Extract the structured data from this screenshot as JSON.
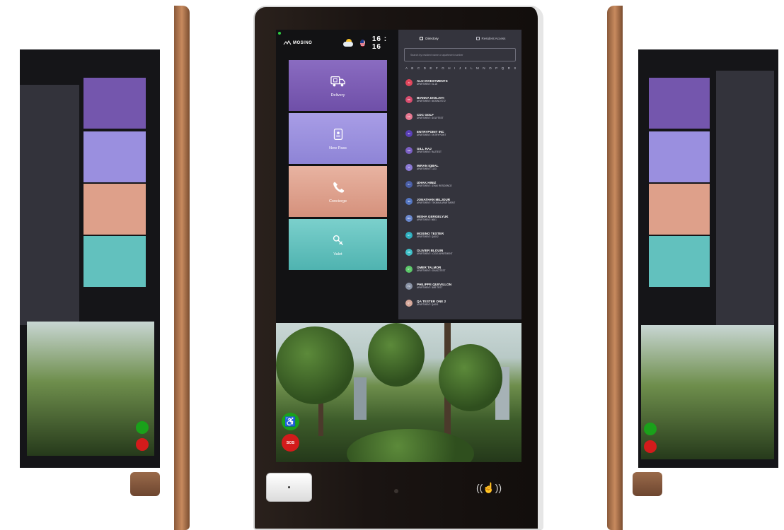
{
  "kiosk": {
    "brand": "MOSINO",
    "time": "16 : 16",
    "tiles": [
      {
        "key": "delivery",
        "label": "Delivery",
        "icon": "delivery-truck-icon"
      },
      {
        "key": "newpass",
        "label": "New Pass",
        "icon": "id-pass-icon"
      },
      {
        "key": "concierge",
        "label": "Concierge",
        "icon": "phone-icon"
      },
      {
        "key": "valet",
        "label": "Valet",
        "icon": "car-key-icon"
      }
    ],
    "tabs": {
      "directory": "Directory",
      "resident_access": "Resident Access"
    },
    "search_placeholder": "Search by resident name or apartment number",
    "alphabet": "A B C D E F G H I J K L M N O P Q R S T U V W X",
    "directory": [
      {
        "initials": "AI",
        "name": "ALO INVESTMENTS",
        "apt": "APARTMENT: 01-18",
        "color": "#e0455b"
      },
      {
        "initials": "BD",
        "name": "BIANKA DIOLAITI",
        "apt": "APARTMENT: MOSINO7072",
        "color": "#d94d6e"
      },
      {
        "initials": "CG",
        "name": "CDC GOLF",
        "apt": "APARTMENT: GOLFTEST",
        "color": "#e87891"
      },
      {
        "initials": "EI",
        "name": "ENTRYPOINT INC",
        "apt": "APARTMENT: ENTRYPOINT",
        "color": "#5a3fb8"
      },
      {
        "initials": "GR",
        "name": "GILL RAJ",
        "apt": "APARTMENT: RAJTEST",
        "color": "#7b5fc4"
      },
      {
        "initials": "II",
        "name": "IMRAN IQBAL",
        "apt": "APARTMENT: 1133",
        "color": "#8c7ad6"
      },
      {
        "initials": "IH",
        "name": "IZHAK HINIZ",
        "apt": "APARTMENT: IZHAK RESIDENCE",
        "color": "#4a5fa8"
      },
      {
        "initials": "JM",
        "name": "JONATHAN MILJOUR",
        "apt": "APARTMENT: TEKNIKA APARTMENT",
        "color": "#5476c2"
      },
      {
        "initials": "MG",
        "name": "MISHA GERGELYUK",
        "apt": "APARTMENT: 8661",
        "color": "#6a88cf"
      },
      {
        "initials": "MT",
        "name": "MOSINO TESTER",
        "apt": "APARTMENT: QA002",
        "color": "#2fb0c0"
      },
      {
        "initials": "OB",
        "name": "OLIVIER BLOUIN",
        "apt": "APARTMENT: LOGIS APARTMENT",
        "color": "#3fc0c8"
      },
      {
        "initials": "OT",
        "name": "OMER TALMOR",
        "apt": "APARTMENT: IGNAZZTEST",
        "color": "#5cc86a"
      },
      {
        "initials": "PQ",
        "name": "PHILIPPE QUEVILLON",
        "apt": "APARTMENT: 3MB TEST",
        "color": "#8a93a6"
      },
      {
        "initials": "QT",
        "name": "QA TESTER ONE 2",
        "apt": "APARTMENT: QA001",
        "color": "#d6a79a"
      }
    ],
    "accessibility_symbol": "♿",
    "sos_label": "SOS",
    "nfc_symbol": "((☝))"
  }
}
